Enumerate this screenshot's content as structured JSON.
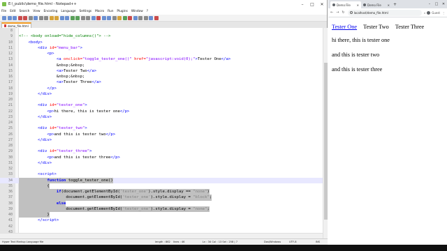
{
  "notepad": {
    "title": "E:\\_public\\demo_file.html - Notepad++",
    "menu": [
      "File",
      "Edit",
      "Search",
      "View",
      "Encoding",
      "Language",
      "Settings",
      "Macro",
      "Run",
      "Plugins",
      "Window",
      "?"
    ],
    "tab_label": "demo_file.html",
    "colors": {
      "tab_accent": "#f29a1f",
      "selection": "#c0c0c0",
      "current_line": "#e8e8ff"
    },
    "lines": [
      {
        "n": "8",
        "html": ""
      },
      {
        "n": "9",
        "html": "<span class='cmt'>&lt;!-- &lt;body onload=\"hide_columns()\"&gt; --&gt;</span>"
      },
      {
        "n": "10",
        "html": "    <span class='tag'>&lt;body&gt;</span>"
      },
      {
        "n": "11",
        "html": "        <span class='tag'>&lt;div</span> <span class='attr'>id=</span><span class='val'>\"menu_bar\"</span><span class='tag'>&gt;</span>"
      },
      {
        "n": "12",
        "html": "            <span class='tag'>&lt;p&gt;</span>"
      },
      {
        "n": "13",
        "html": "                <span class='tag'>&lt;a</span> <span class='attr'>onclick=</span><span class='val'>\"toggle_tester_one()\"</span> <span class='attr'>href=</span><span class='val'>\"javascript:void(0);\"</span><span class='tag'>&gt;</span>Tester One<span class='tag'>&lt;/a&gt;</span>"
      },
      {
        "n": "14",
        "html": "                <span class='ent'>&amp;nbsp;&amp;nbsp;</span>"
      },
      {
        "n": "15",
        "html": "                <span class='tag'>&lt;a&gt;</span>Tester Two<span class='tag'>&lt;/a&gt;</span>"
      },
      {
        "n": "16",
        "html": "                <span class='ent'>&amp;nbsp;&amp;nbsp;</span>"
      },
      {
        "n": "17",
        "html": "                <span class='tag'>&lt;a&gt;</span>Tester Three<span class='tag'>&lt;/a&gt;</span>"
      },
      {
        "n": "18",
        "html": "            <span class='tag'>&lt;/p&gt;</span>"
      },
      {
        "n": "19",
        "html": "        <span class='tag'>&lt;/div&gt;</span>"
      },
      {
        "n": "20",
        "html": ""
      },
      {
        "n": "21",
        "html": "        <span class='tag'>&lt;div</span> <span class='attr'>id=</span><span class='val'>\"tester_one\"</span><span class='tag'>&gt;</span>"
      },
      {
        "n": "22",
        "html": "            <span class='tag'>&lt;p&gt;</span>hi there, this is tester one<span class='tag'>&lt;/p&gt;</span>"
      },
      {
        "n": "23",
        "html": "        <span class='tag'>&lt;/div&gt;</span>"
      },
      {
        "n": "24",
        "html": ""
      },
      {
        "n": "25",
        "html": "        <span class='tag'>&lt;div</span> <span class='attr'>id=</span><span class='val'>\"tester_two\"</span><span class='tag'>&gt;</span>"
      },
      {
        "n": "26",
        "html": "            <span class='tag'>&lt;p&gt;</span>and this is tester two<span class='tag'>&lt;/p&gt;</span>"
      },
      {
        "n": "27",
        "html": "        <span class='tag'>&lt;/div&gt;</span>"
      },
      {
        "n": "28",
        "html": ""
      },
      {
        "n": "29",
        "html": "        <span class='tag'>&lt;div</span> <span class='attr'>id=</span><span class='val'>\"tester_three\"</span><span class='tag'>&gt;</span>"
      },
      {
        "n": "30",
        "html": "            <span class='tag'>&lt;p&gt;</span>and this is tester three<span class='tag'>&lt;/p&gt;</span>"
      },
      {
        "n": "31",
        "html": "        <span class='tag'>&lt;/div&gt;</span>"
      },
      {
        "n": "32",
        "html": ""
      },
      {
        "n": "33",
        "html": "        <span class='tag'>&lt;script&gt;</span>"
      },
      {
        "n": "34",
        "html": "            <span class='kw'>function</span> toggle_tester_one()",
        "sel": true,
        "current": true
      },
      {
        "n": "35",
        "html": "            {",
        "sel": true
      },
      {
        "n": "36",
        "html": "                <span class='kw'>if</span>(document.getElementById(<span class='str'>'tester_one'</span>).style.display == <span class='str'>\"none\"</span>)",
        "sel": true
      },
      {
        "n": "37",
        "html": "                    document.getElementById(<span class='str'>'tester_one'</span>).style.display = <span class='str'>\"block\"</span>;",
        "sel": true
      },
      {
        "n": "38",
        "html": "                <span class='kw'>else</span>",
        "sel": true
      },
      {
        "n": "39",
        "html": "                    document.getElementById(<span class='str'>'tester_one'</span>).style.display = <span class='str'>\"none\"</span>;",
        "sel": true
      },
      {
        "n": "40",
        "html": "            }",
        "sel": true
      },
      {
        "n": "41",
        "html": "        <span class='tag'>&lt;/script&gt;</span>"
      },
      {
        "n": "42",
        "html": ""
      },
      {
        "n": "43",
        "html": ""
      }
    ],
    "status": {
      "language": "Hyper Text Markup Language file",
      "length": "length : 862",
      "lines": "lines : 46",
      "position": "Ln : 34    Col : 13    Sel : 258 | 7",
      "eol": "Dos\\Windows",
      "encoding": "UTF-8",
      "ins": "INS"
    }
  },
  "browser": {
    "tabs": [
      {
        "label": "Demo File",
        "active": true
      },
      {
        "label": "Demo File",
        "active": false
      }
    ],
    "new_tab": "+",
    "url": "localhost/demo_file.html",
    "profile": "Guest",
    "page": {
      "menu_links": [
        "Tester One",
        "Tester Two",
        "Tester Three"
      ],
      "paragraphs": [
        "hi there, this is tester one",
        "and this is tester two",
        "and this is tester three"
      ]
    },
    "colors": {
      "link": "#0000ee"
    }
  }
}
